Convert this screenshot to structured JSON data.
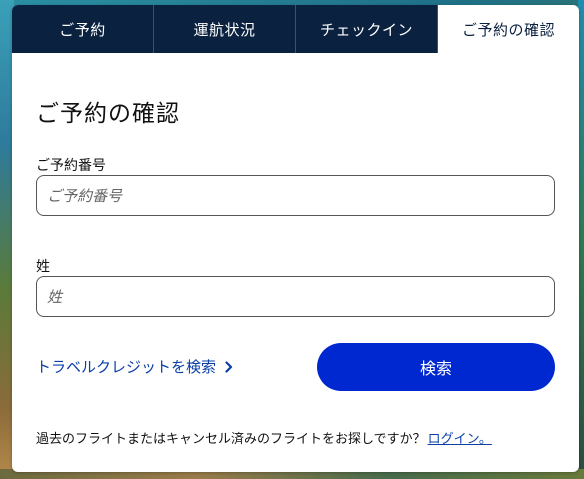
{
  "tabs": [
    {
      "label": "ご予約"
    },
    {
      "label": "運航状況"
    },
    {
      "label": "チェックイン"
    },
    {
      "label": "ご予約の確認",
      "active": true
    }
  ],
  "form": {
    "title": "ご予約の確認",
    "reservation_label": "ご予約番号",
    "reservation_placeholder": "ご予約番号",
    "reservation_value": "",
    "lastname_label": "姓",
    "lastname_placeholder": "姓",
    "lastname_value": "",
    "travel_credit_link": "トラベルクレジットを検索",
    "search_button": "検索"
  },
  "footer": {
    "question": "過去のフライトまたはキャンセル済みのフライトをお探しですか？",
    "login_link": "ログイン。"
  },
  "icons": {
    "travel_credit_chevron": "chevron-right-icon"
  },
  "colors": {
    "tab_bar": "#0a2240",
    "link": "#0a3fa8",
    "primary_button": "#0028d0"
  }
}
